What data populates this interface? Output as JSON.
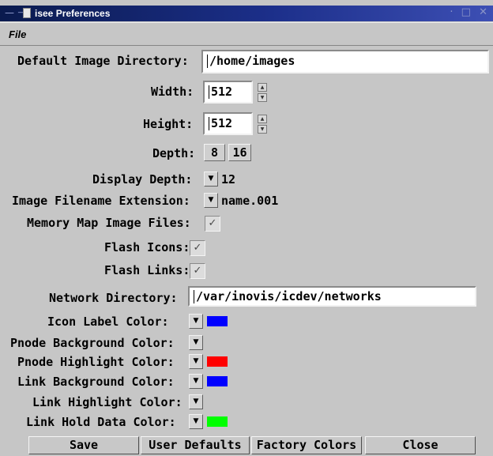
{
  "window": {
    "title": "isee Preferences"
  },
  "menu": {
    "file": "File"
  },
  "fields": {
    "default_image_directory": {
      "label": "Default Image Directory:",
      "value": "/home/images"
    },
    "width": {
      "label": "Width:",
      "value": "512"
    },
    "height": {
      "label": "Height:",
      "value": "512"
    },
    "depth": {
      "label": "Depth:",
      "options": [
        "8",
        "16"
      ]
    },
    "display_depth": {
      "label": "Display Depth:",
      "value": "12"
    },
    "image_filename_extension": {
      "label": "Image Filename Extension:",
      "value": "name.001"
    },
    "memory_map_image_files": {
      "label": "Memory Map Image Files:",
      "checked": true
    },
    "flash_icons": {
      "label": "Flash Icons:",
      "checked": true
    },
    "flash_links": {
      "label": "Flash Links:",
      "checked": true
    },
    "network_directory": {
      "label": "Network Directory:",
      "value": "/var/inovis/icdev/networks"
    }
  },
  "colors": {
    "icon_label": {
      "label": "Icon Label Color:",
      "swatch": "#0000ff"
    },
    "pnode_background": {
      "label": "Pnode Background Color:",
      "swatch": null
    },
    "pnode_highlight": {
      "label": "Pnode Highlight Color:",
      "swatch": "#ff0000"
    },
    "link_background": {
      "label": "Link Background Color:",
      "swatch": "#0000ff"
    },
    "link_highlight": {
      "label": "Link Highlight Color:",
      "swatch": null
    },
    "link_hold_data": {
      "label": "Link Hold Data Color:",
      "swatch": "#00ff00"
    }
  },
  "buttons": {
    "save": "Save",
    "user_defaults": "User Defaults",
    "factory_colors": "Factory Colors",
    "close": "Close"
  },
  "icons": {
    "dropdown": "▼",
    "spin_up": "▲",
    "spin_down": "▼",
    "check": "✓"
  }
}
